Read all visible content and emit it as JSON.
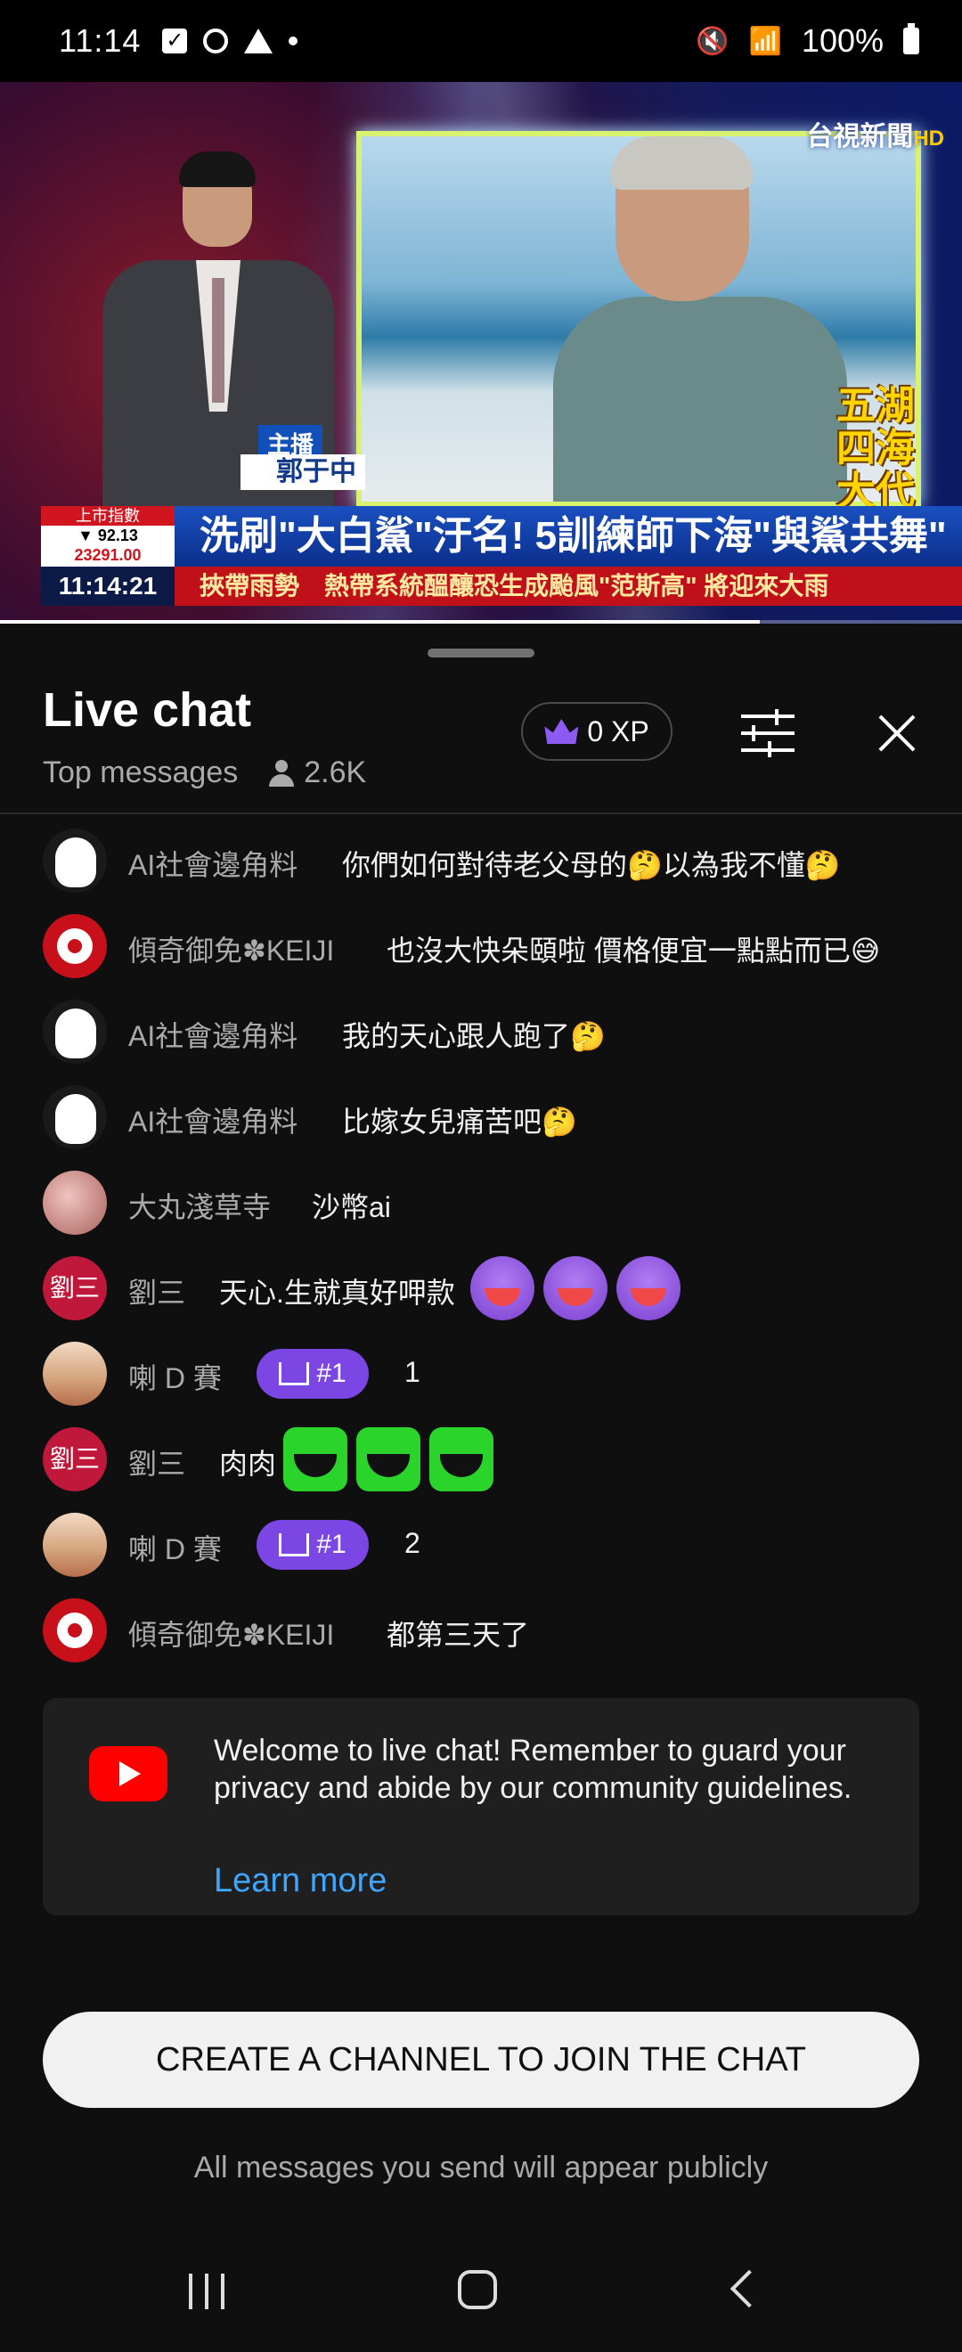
{
  "status_bar": {
    "time": "11:14",
    "battery": "100%"
  },
  "video": {
    "channel_logo": "台視新聞",
    "channel_logo_suffix": "HD",
    "show_name": "五湖四海大代誌",
    "anchor_tag": "主播",
    "anchor_name": "郭于中",
    "ticker_label": "上市指數",
    "ticker_change": "▼ 92.13",
    "ticker_value": "23291.00",
    "headline": "洗刷\"大白鯊\"汙名! 5訓練師下海\"與鯊共舞\"",
    "clock": "11:14:21",
    "crawl": "挾帶雨勢　熱帶系統醞釀恐生成颱風\"范斯高\" 將迎來大雨",
    "progress_fraction": 0.79
  },
  "chat": {
    "title": "Live chat",
    "mode": "Top messages",
    "viewer_count": "2.6K",
    "xp_label": "0 XP",
    "messages": [
      {
        "avatar": "moomin",
        "author": "AI社會邊角料",
        "text": "你們如何對待老父母的🤔以為我不懂🤔"
      },
      {
        "avatar": "keiji",
        "author": "傾奇御免✽KEIJI",
        "text": "也沒大快朵頤啦 價格便宜一點點而已😅"
      },
      {
        "avatar": "moomin",
        "author": "AI社會邊角料",
        "text": "我的天心跟人跑了🤔"
      },
      {
        "avatar": "moomin",
        "author": "AI社會邊角料",
        "text": "比嫁女兒痛苦吧🤔"
      },
      {
        "avatar": "pink",
        "author": "大丸淺草寺",
        "text": "沙幣ai"
      },
      {
        "avatar": "liu",
        "author": "劉三",
        "text": "天心.生就真好呷款",
        "avatar_text": "劉三"
      },
      {
        "avatar": "la",
        "author": "喇 D 賽",
        "badge": "#1",
        "text": "1"
      },
      {
        "avatar": "liu",
        "author": "劉三",
        "text": "肉肉",
        "avatar_text": "劉三"
      },
      {
        "avatar": "la",
        "author": "喇 D 賽",
        "badge": "#1",
        "text": "2"
      },
      {
        "avatar": "keiji",
        "author": "傾奇御免✽KEIJI",
        "text": "都第三天了"
      }
    ],
    "welcome_text": "Welcome to live chat! Remember to guard your privacy and abide by our community guidelines.",
    "learn_more": "Learn more",
    "create_button": "CREATE A CHANNEL TO JOIN THE CHAT",
    "public_note": "All messages you send will appear publicly"
  },
  "colors": {
    "accent_link": "#3ea6ff",
    "badge_purple": "#7b46e3",
    "youtube_red": "#ff0000"
  }
}
